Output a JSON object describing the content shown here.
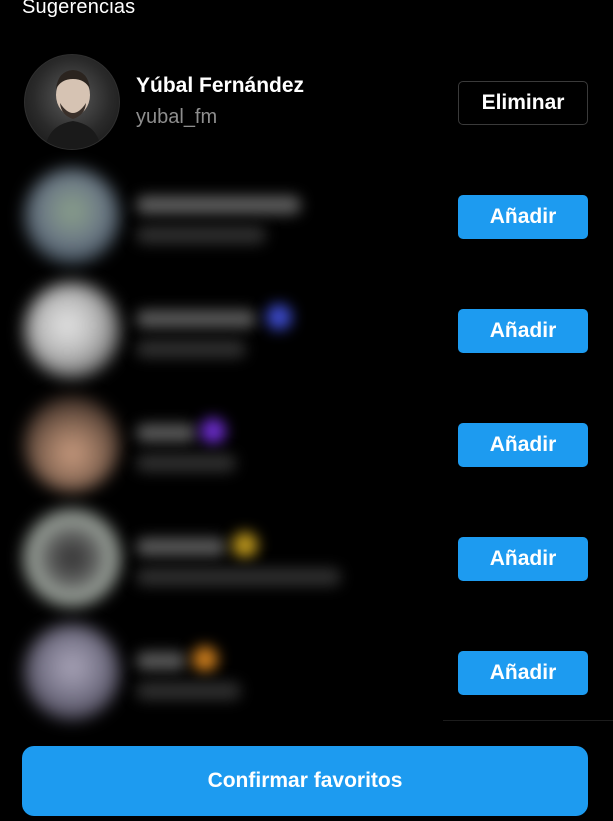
{
  "header": {
    "title": "Sugerencias"
  },
  "suggestions": [
    {
      "name": "Yúbal Fernández",
      "username": "yubal_fm",
      "action_label": "Eliminar",
      "state": "added"
    },
    {
      "action_label": "Añadir",
      "state": "suggested"
    },
    {
      "action_label": "Añadir",
      "state": "suggested"
    },
    {
      "action_label": "Añadir",
      "state": "suggested"
    },
    {
      "action_label": "Añadir",
      "state": "suggested"
    },
    {
      "action_label": "Añadir",
      "state": "suggested"
    }
  ],
  "footer": {
    "confirm_label": "Confirmar favoritos"
  },
  "colors": {
    "background": "#000000",
    "accent": "#1d9bf0",
    "secondary_text": "#8e8e8e"
  }
}
